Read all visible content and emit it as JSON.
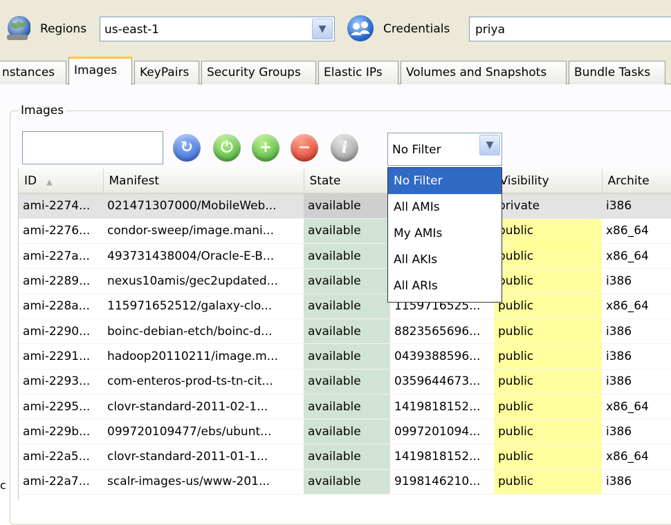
{
  "topbar": {
    "regions_label": "Regions",
    "region_value": "us-east-1",
    "credentials_label": "Credentials",
    "credentials_value": "priya"
  },
  "tabs": [
    "nstances",
    "Images",
    "KeyPairs",
    "Security Groups",
    "Elastic IPs",
    "Volumes and Snapshots",
    "Bundle Tasks"
  ],
  "active_tab": "Images",
  "images": {
    "group_title": "Images",
    "search_value": "",
    "toolbar_icons": [
      "refresh-icon",
      "power-icon",
      "plus-icon",
      "minus-icon",
      "info-icon"
    ],
    "filter_value": "No Filter",
    "filter_options": [
      "No Filter",
      "All AMIs",
      "My AMIs",
      "All AKIs",
      "All ARIs"
    ],
    "columns": [
      "ID",
      "Manifest",
      "State",
      "",
      "Visibility",
      "Archite"
    ],
    "rows": [
      [
        "ami-2274...",
        "021471307000/MobileWeb...",
        "available",
        "",
        "private",
        "i386"
      ],
      [
        "ami-2276...",
        "condor-sweep/image.mani...",
        "available",
        "",
        "public",
        "x86_64"
      ],
      [
        "ami-227a...",
        "493731438004/Oracle-E-B...",
        "available",
        "",
        "public",
        "x86_64"
      ],
      [
        "ami-2289...",
        "nexus10amis/gec2updated...",
        "available",
        "",
        "public",
        "i386"
      ],
      [
        "ami-228a...",
        "115971652512/galaxy-clo...",
        "available",
        "1159716525...",
        "public",
        "x86_64"
      ],
      [
        "ami-2290...",
        "boinc-debian-etch/boinc-d...",
        "available",
        "8823565696...",
        "public",
        "i386"
      ],
      [
        "ami-2291...",
        "hadoop20110211/image.m...",
        "available",
        "0439388596...",
        "public",
        "i386"
      ],
      [
        "ami-2293...",
        "com-enteros-prod-ts-tn-cit...",
        "available",
        "0359644673...",
        "public",
        "i386"
      ],
      [
        "ami-2295...",
        "clovr-standard-2011-02-1...",
        "available",
        "1419818152...",
        "public",
        "x86_64"
      ],
      [
        "ami-229b...",
        "099720109477/ebs/ubunt...",
        "available",
        "0997201094...",
        "public",
        "i386"
      ],
      [
        "ami-22a5...",
        "clovr-standard-2011-01-1...",
        "available",
        "1419818152...",
        "public",
        "x86_64"
      ],
      [
        "ami-22a7...",
        "scalr-images-us/www-201...",
        "available",
        "9198146210...",
        "public",
        "i386"
      ]
    ]
  },
  "edge_letter": "c",
  "colors": {
    "state_cell": "#d1e3d4",
    "public_cell": "#ffff9f",
    "selected_row": "#e3e3e3",
    "dropdown_highlight": "#316ac5",
    "active_tab_accent": "#ffc83c"
  }
}
